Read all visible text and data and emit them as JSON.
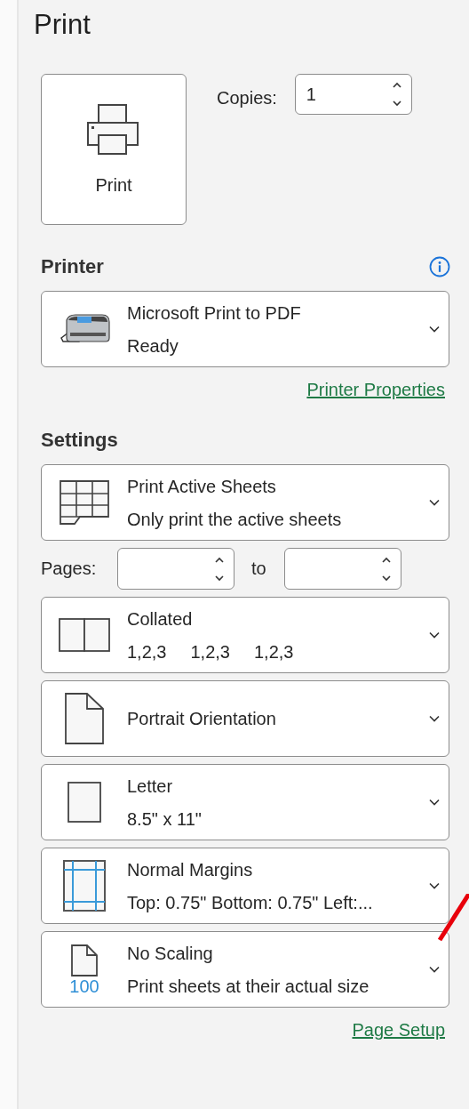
{
  "title": "Print",
  "print_button": {
    "label": "Print"
  },
  "copies": {
    "label": "Copies:",
    "value": "1"
  },
  "printer": {
    "heading": "Printer",
    "name": "Microsoft Print to PDF",
    "status": "Ready",
    "link": "Printer Properties"
  },
  "settings": {
    "heading": "Settings",
    "items": [
      {
        "kind": "sheets",
        "title": "Print Active Sheets",
        "subtitle": "Only print the active sheets"
      },
      {
        "kind": "pages",
        "label": "Pages:",
        "separator": "to"
      },
      {
        "kind": "collated",
        "title": "Collated",
        "subtitle_parts": [
          "1,2,3",
          "1,2,3",
          "1,2,3"
        ]
      },
      {
        "kind": "portrait",
        "title": "Portrait Orientation"
      },
      {
        "kind": "letter",
        "title": "Letter",
        "subtitle": "8.5\" x 11\""
      },
      {
        "kind": "margins",
        "title": "Normal Margins",
        "subtitle": "Top: 0.75\" Bottom: 0.75\" Left:..."
      },
      {
        "kind": "scaling",
        "title": "No Scaling",
        "subtitle": "Print sheets at their actual size",
        "icon_text": "100"
      }
    ],
    "link": "Page Setup"
  }
}
